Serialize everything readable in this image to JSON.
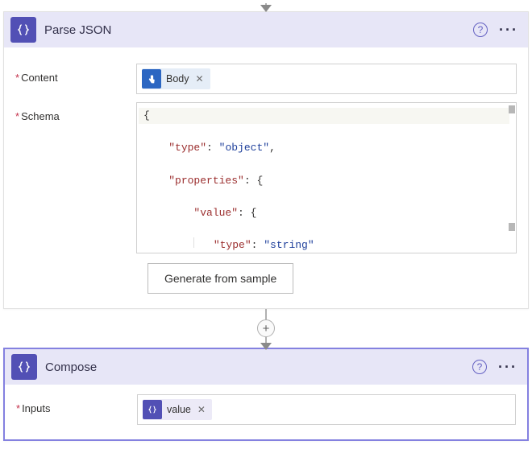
{
  "actions": {
    "parse": {
      "title": "Parse JSON",
      "contentLabel": "Content",
      "schemaLabel": "Schema",
      "contentToken": "Body",
      "schemaPreview": {
        "l1": "{",
        "l2_k": "\"type\"",
        "l2_v": "\"object\"",
        "l3_k": "\"properties\"",
        "l4_k": "\"value\"",
        "l5_k": "\"type\"",
        "l5_v": "\"string\"",
        "l6": "}",
        "l7": "}",
        "l8": "}"
      },
      "generateLabel": "Generate from sample"
    },
    "compose": {
      "title": "Compose",
      "inputsLabel": "Inputs",
      "inputsToken": "value"
    }
  },
  "glyphs": {
    "close": "✕",
    "help": "?",
    "more": "···",
    "plus": "+"
  }
}
